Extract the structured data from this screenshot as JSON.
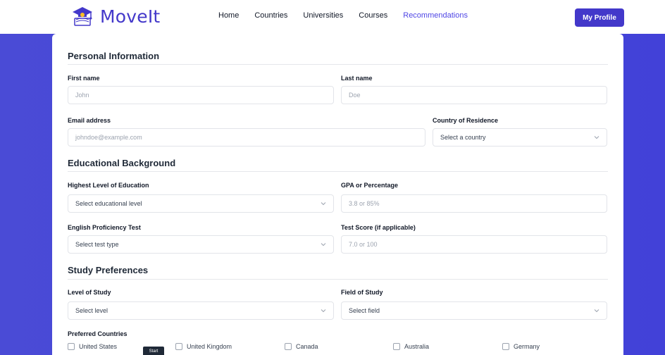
{
  "brand": {
    "name": "MoveIt"
  },
  "nav": {
    "links": [
      "Home",
      "Countries",
      "Universities",
      "Courses",
      "Recommendations"
    ],
    "profile_label": "My Profile"
  },
  "personal": {
    "title": "Personal Information",
    "first_name_label": "First name",
    "first_name_placeholder": "John",
    "last_name_label": "Last name",
    "last_name_placeholder": "Doe",
    "email_label": "Email address",
    "email_placeholder": "johndoe@example.com",
    "country_label": "Country of Residence",
    "country_value": "Select a country"
  },
  "education": {
    "title": "Educational Background",
    "level_label": "Highest Level of Education",
    "level_value": "Select educational level",
    "gpa_label": "GPA or Percentage",
    "gpa_placeholder": "3.8 or 85%",
    "test_label": "English Proficiency Test",
    "test_value": "Select test type",
    "score_label": "Test Score (if applicable)",
    "score_placeholder": "7.0 or 100"
  },
  "preferences": {
    "title": "Study Preferences",
    "level_label": "Level of Study",
    "level_value": "Select level",
    "field_label": "Field of Study",
    "field_value": "Select field",
    "countries_label": "Preferred Countries",
    "countries": [
      "United States",
      "United Kingdom",
      "Canada",
      "Australia",
      "Germany"
    ]
  },
  "tooltip": {
    "text": "Start"
  },
  "colors": {
    "brand": "#4338ca",
    "accent": "#4f46e5",
    "background": "#4547da"
  }
}
